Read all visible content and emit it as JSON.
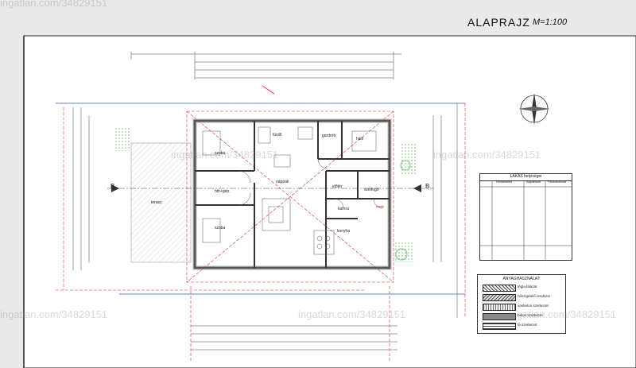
{
  "drawing": {
    "title": "ALAPRAJZ",
    "scale": "M=1:100"
  },
  "rooms": [
    {
      "name": "szoba"
    },
    {
      "name": "fürdő"
    },
    {
      "name": "gardrób"
    },
    {
      "name": "háló"
    },
    {
      "name": "nappali"
    },
    {
      "name": "hth+gép."
    },
    {
      "name": "szoba"
    },
    {
      "name": "kamra"
    },
    {
      "name": "konyha"
    },
    {
      "name": "terasz"
    },
    {
      "name": "előtér"
    },
    {
      "name": "szélfogó"
    }
  ],
  "section_markers": [
    "B",
    "B"
  ],
  "table": {
    "title": "LAKÁS helyiségei",
    "columns": [
      "Rendeltetés",
      "Alapterület",
      "Padlóburkolat"
    ]
  },
  "legend": {
    "title": "ANYAGHASZNÁLAT:",
    "items": [
      "tégla falazat",
      "hőszigetelő rendszer",
      "vasbeton szerkezet",
      "beton szerkezet",
      "fa szerkezet"
    ]
  },
  "watermarks": [
    "ingatlan.com/34829151",
    "ingatlan.com/34829151",
    "ingatlan.com/34829151",
    "ingatlan.com/34829151",
    "ingatlan.com/34829151",
    "ingatlan.com/34829151"
  ]
}
